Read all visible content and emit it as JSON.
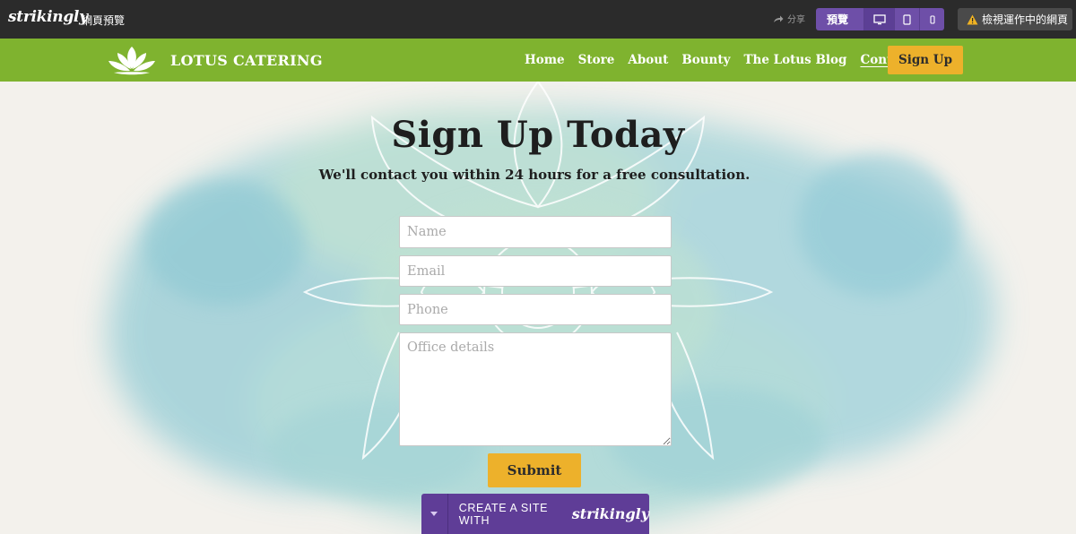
{
  "editor": {
    "brand": "strikingly",
    "preview_label": "網頁預覽",
    "share_label": "分享",
    "preview_mode_label": "預覽",
    "device_icons": [
      "desktop-icon",
      "tablet-icon",
      "mobile-icon"
    ],
    "view_live_label": "檢視運作中的網頁"
  },
  "site": {
    "name": "LOTUS CATERING",
    "nav_links": [
      "Home",
      "Store",
      "About",
      "Bounty",
      "The Lotus Blog",
      "Contact"
    ],
    "active_link": "Contact",
    "nav_cta": "Sign Up"
  },
  "hero": {
    "title": "Sign Up Today",
    "subtitle": "We'll contact you within 24 hours for a free consultation."
  },
  "form": {
    "name_placeholder": "Name",
    "email_placeholder": "Email",
    "phone_placeholder": "Phone",
    "office_placeholder": "Office details",
    "submit_label": "Submit"
  },
  "badge": {
    "cta_text": "CREATE A SITE WITH",
    "cta_brand": "strikingly"
  },
  "colors": {
    "topbar": "#2b2b2b",
    "nav": "#7fb32f",
    "accent": "#edb12b",
    "purple": "#6e4fa8"
  }
}
